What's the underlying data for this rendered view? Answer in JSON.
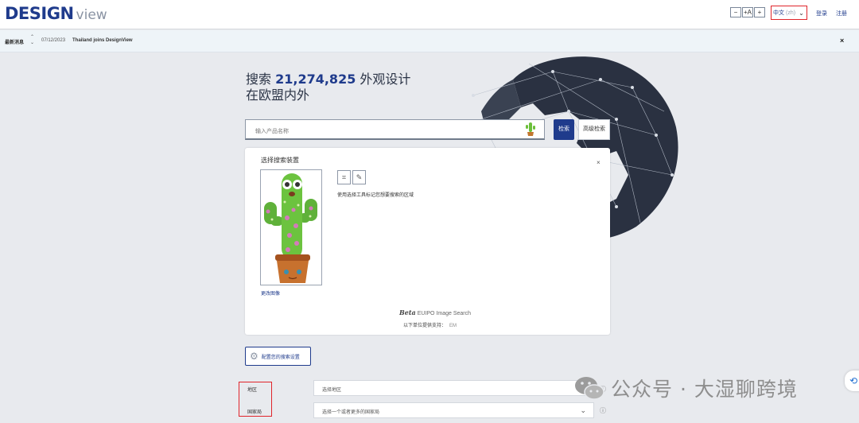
{
  "header": {
    "logo_main": "DESIGN",
    "logo_sub": "view",
    "zoom": {
      "decrease": "−",
      "reset": "+A",
      "increase": "+"
    },
    "language": {
      "value": "中文",
      "code": "(zh)"
    },
    "login": "登录",
    "register": "注册"
  },
  "news": {
    "label": "最新消息",
    "date": "07/12/2023",
    "text": "Thailand joins DesignView",
    "close": "×"
  },
  "hero": {
    "prefix": "搜索",
    "count": "21,274,825",
    "suffix": "外观设计",
    "line2": "在欧盟内外"
  },
  "search": {
    "placeholder": "输入产品名称",
    "search_button": "检索",
    "advanced_button": "高级检索"
  },
  "image_panel": {
    "title": "选择搜索装置",
    "close": "×",
    "change_image": "更改图像",
    "tool_hint": "使用选择工具标记您想要搜索的区域",
    "beta_label": "Beta",
    "beta_text": "EUIPO Image Search",
    "support_label": "以下单位提供支持：",
    "support_value": "EM"
  },
  "configure_button": "配置您的搜索设置",
  "filters": {
    "region_label": "地区",
    "region_placeholder": "选择地区",
    "office_label": "国家局",
    "office_placeholder": "选择一个或者更多的国家局"
  },
  "watermark": "公众号 · 大湿聊跨境",
  "colors": {
    "brand": "#1f3b8c",
    "highlight": "#e0242a",
    "background": "#e8eaee"
  }
}
